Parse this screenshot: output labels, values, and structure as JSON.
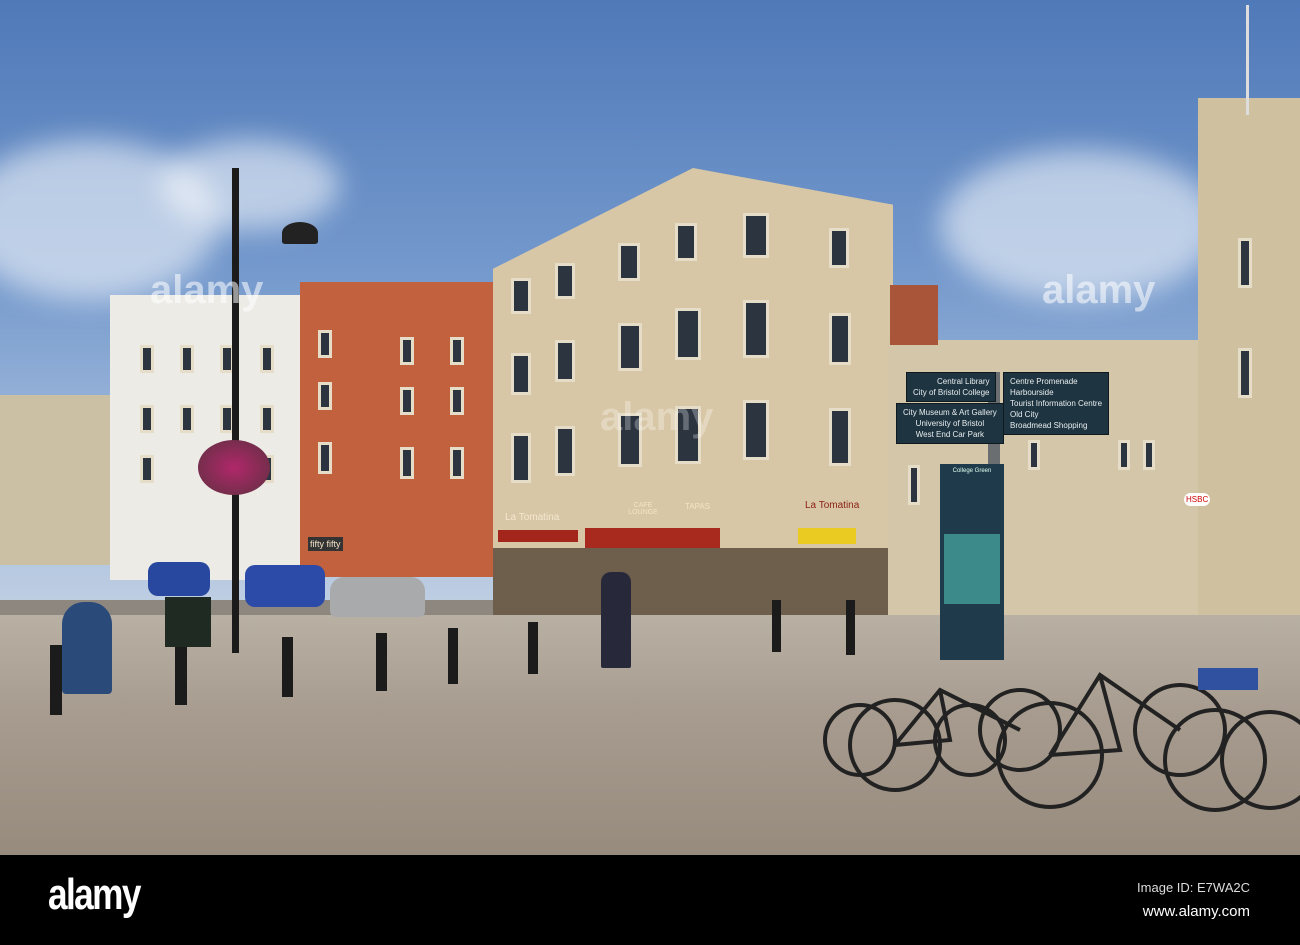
{
  "photo": {
    "signpost": {
      "left_top": [
        "Central Library",
        "City of Bristol College"
      ],
      "left_bottom": [
        "City Museum & Art Gallery",
        "University of Bristol",
        "West End Car Park"
      ],
      "right": [
        "Centre Promenade",
        "Harbourside",
        "Tourist Information Centre",
        "Old City",
        "Broadmead Shopping"
      ]
    },
    "shops": {
      "la_tomatina_1": "La Tomatina",
      "cafe_lounge": "CAFE LOUNGE",
      "tapas": "TAPAS",
      "la_tomatina_2": "La Tomatina",
      "fifty_fifty": "fifty fifty",
      "hsbc": "HSBC",
      "college_green": "College Green"
    },
    "watermark": "alamy"
  },
  "footer": {
    "logo": "alamy",
    "image_id": "Image ID: E7WA2C",
    "website": "www.alamy.com"
  }
}
